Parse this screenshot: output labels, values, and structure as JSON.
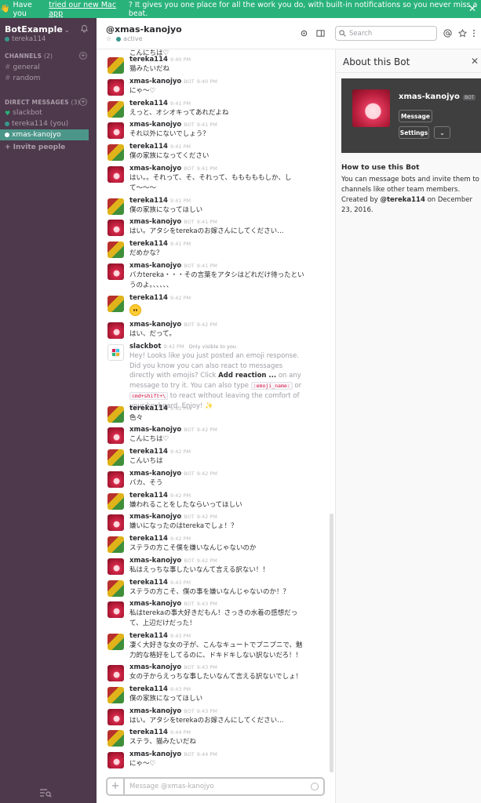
{
  "banner": {
    "prefix": "Have you",
    "link": "tried our new Mac app",
    "suffix": "? It gives you one place for all the work you do, with built-in notifications so you never miss a beat."
  },
  "sidebar": {
    "team_name": "BotExample",
    "user": "tereka114",
    "channels_label": "CHANNELS",
    "channels_count": "(2)",
    "channels": [
      {
        "label": "general"
      },
      {
        "label": "random"
      }
    ],
    "dm_label": "DIRECT MESSAGES",
    "dm_count": "(3)",
    "dms": [
      {
        "label": "slackbot"
      },
      {
        "label": "tereka114 (you)"
      },
      {
        "label": "xmas-kanojyo"
      }
    ],
    "invite": "+ Invite people"
  },
  "header": {
    "title": "@xmas-kanojyo",
    "status": "active",
    "search_placeholder": "Search"
  },
  "messages": [
    {
      "user": "",
      "time": "",
      "text": "こんにちは♡"
    },
    {
      "user": "tereka114",
      "time": "9:40 PM",
      "text": "猫みたいだね"
    },
    {
      "user": "xmas-kanojyo",
      "bot": "BOT",
      "time": "9:40 PM",
      "text": "にゃ〜♡"
    },
    {
      "user": "tereka114",
      "time": "9:41 PM",
      "text": "えっと、オシオキってあれだよね"
    },
    {
      "user": "xmas-kanojyo",
      "bot": "BOT",
      "time": "9:41 PM",
      "text": "それ以外にないでしょう？"
    },
    {
      "user": "tereka114",
      "time": "9:41 PM",
      "text": "僕の家族になってください"
    },
    {
      "user": "xmas-kanojyo",
      "bot": "BOT",
      "time": "9:41 PM",
      "text": "はい。。それって、そ、それって、もももももしか、して〜〜〜"
    },
    {
      "user": "tereka114",
      "time": "9:41 PM",
      "text": "僕の家族になってほしい"
    },
    {
      "user": "xmas-kanojyo",
      "bot": "BOT",
      "time": "9:41 PM",
      "text": "はい。アタシをterekaのお嫁さんにしてください…"
    },
    {
      "user": "tereka114",
      "time": "9:41 PM",
      "text": "だめかな？"
    },
    {
      "user": "xmas-kanojyo",
      "bot": "BOT",
      "time": "9:41 PM",
      "text": "バカtereka・・・その言葉をアタシはどれだけ待ったというのよ。、、、、、"
    },
    {
      "user": "tereka114",
      "time": "9:42 PM",
      "text": ""
    },
    {
      "user": "xmas-kanojyo",
      "bot": "BOT",
      "time": "9:42 PM",
      "text": "はい、だって。"
    },
    {
      "user": "slackbot",
      "time": "9:42 PM",
      "note": "Only visible to you",
      "text": ""
    },
    {
      "user": "tereka114",
      "time": "9:42 PM",
      "text": "色々"
    },
    {
      "user": "xmas-kanojyo",
      "bot": "BOT",
      "time": "9:42 PM",
      "text": "こんにちは♡"
    },
    {
      "user": "tereka114",
      "time": "9:42 PM",
      "text": "こんいちは"
    },
    {
      "user": "xmas-kanojyo",
      "bot": "BOT",
      "time": "9:42 PM",
      "text": "バカ、そう"
    },
    {
      "user": "tereka114",
      "time": "9:42 PM",
      "text": "嫌われることをしたならいってほしい"
    },
    {
      "user": "xmas-kanojyo",
      "bot": "BOT",
      "time": "9:42 PM",
      "text": "嫌いになったのはterekaでしょ！？"
    },
    {
      "user": "tereka114",
      "time": "9:42 PM",
      "text": "ステラの方こそ僕を嫌いなんじゃないのか"
    },
    {
      "user": "xmas-kanojyo",
      "bot": "BOT",
      "time": "9:42 PM",
      "text": "私はえっちな事したいなんて言える訳ない！！"
    },
    {
      "user": "tereka114",
      "time": "9:43 PM",
      "text": "ステラの方こそ、僕の事を嫌いなんじゃないのか！？"
    },
    {
      "user": "xmas-kanojyo",
      "bot": "BOT",
      "time": "9:43 PM",
      "text": "私はterekaの事大好きだもん！さっきの水着の感想だって、上辺だけだった！"
    },
    {
      "user": "tereka114",
      "time": "9:43 PM",
      "text": "凄く大好きな女の子が、こんなキュートでプニプニで、魅力的な格好をしてるのに、ドキドキしない訳ないだろ！！"
    },
    {
      "user": "xmas-kanojyo",
      "bot": "BOT",
      "time": "9:43 PM",
      "text": "女の子からえっちな事したいなんて言える訳ないでしょ！"
    },
    {
      "user": "tereka114",
      "time": "9:43 PM",
      "text": "僕の家族になってほしい"
    },
    {
      "user": "xmas-kanojyo",
      "bot": "BOT",
      "time": "9:43 PM",
      "text": "はい。アタシをterekaのお嫁さんにしてください…"
    },
    {
      "user": "tereka114",
      "time": "9:44 PM",
      "text": "ステラ、猫みたいだね"
    },
    {
      "user": "xmas-kanojyo",
      "bot": "BOT",
      "time": "9:44 PM",
      "text": "にゃ〜♡"
    }
  ],
  "slackbot_msg": {
    "t1": "Hey! Looks like you just posted an emoji response. Did you know you can also react to messages directly with emojis? Click ",
    "bold": "Add reaction ...",
    "t2": " on any message to try it. You can also type ",
    "code1": ":emoji_name:",
    "t3": " or ",
    "code2": "cmd+shift+\\",
    "t4": " to react without leaving the comfort of your keyboard. Enjoy! ✨"
  },
  "composer": {
    "placeholder": "Message @xmas-kanojyo"
  },
  "panel": {
    "title": "About this Bot",
    "bot_name": "xmas-kanojyo",
    "bot_tag": "BOT",
    "message_btn": "Message",
    "settings_btn": "Settings",
    "how_title": "How to use this Bot",
    "how_text": "You can message bots and invite them to channels like other team members. Created by ",
    "creator": "@tereka114",
    "date_text": " on December 23, 2016."
  },
  "colors": {
    "sidebar": "#4d394b",
    "active": "#4c9689",
    "banner": "#2ab27b"
  }
}
